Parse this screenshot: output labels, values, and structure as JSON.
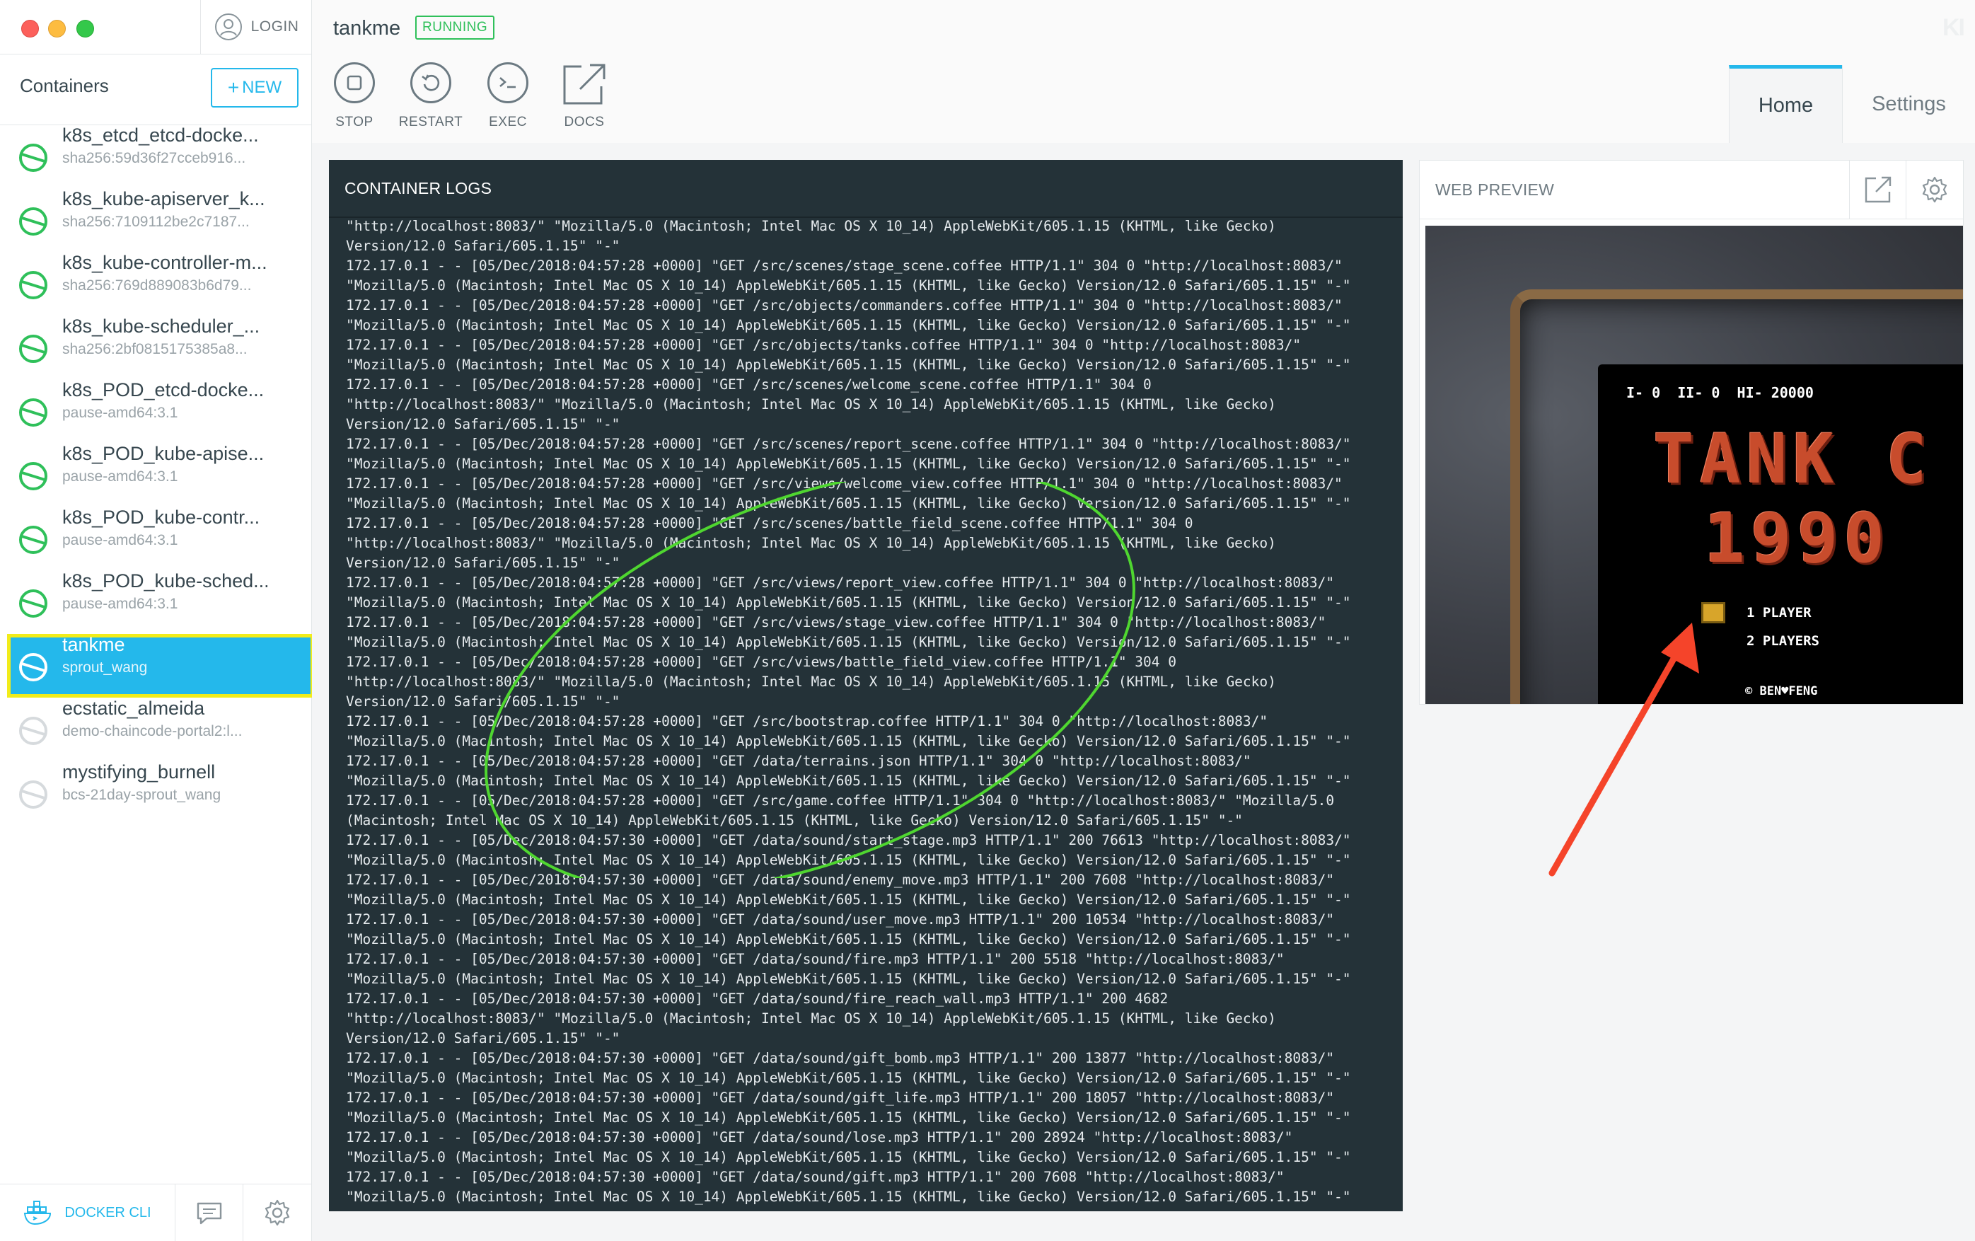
{
  "sidebar": {
    "login_label": "LOGIN",
    "containers_title": "Containers",
    "new_button": "NEW",
    "items": [
      {
        "name": "k8s_etcd_etcd-docke...",
        "sub": "sha256:59d36f27cceb916...",
        "state": "running"
      },
      {
        "name": "k8s_kube-apiserver_k...",
        "sub": "sha256:7109112be2c7187...",
        "state": "running"
      },
      {
        "name": "k8s_kube-controller-m...",
        "sub": "sha256:769d889083b6d79...",
        "state": "running"
      },
      {
        "name": "k8s_kube-scheduler_...",
        "sub": "sha256:2bf0815175385a8...",
        "state": "running"
      },
      {
        "name": "k8s_POD_etcd-docke...",
        "sub": "pause-amd64:3.1",
        "state": "running"
      },
      {
        "name": "k8s_POD_kube-apise...",
        "sub": "pause-amd64:3.1",
        "state": "running"
      },
      {
        "name": "k8s_POD_kube-contr...",
        "sub": "pause-amd64:3.1",
        "state": "running"
      },
      {
        "name": "k8s_POD_kube-sched...",
        "sub": "pause-amd64:3.1",
        "state": "running"
      },
      {
        "name": "tankme",
        "sub": "sprout_wang",
        "state": "selected"
      },
      {
        "name": "ecstatic_almeida",
        "sub": "demo-chaincode-portal2:l...",
        "state": "stopped"
      },
      {
        "name": "mystifying_burnell",
        "sub": "bcs-21day-sprout_wang",
        "state": "stopped"
      }
    ],
    "footer": {
      "docker_cli": "DOCKER CLI"
    }
  },
  "header": {
    "container_name": "tankme",
    "status": "RUNNING",
    "brand": "KI"
  },
  "toolbar": {
    "stop": "STOP",
    "restart": "RESTART",
    "exec": "EXEC",
    "docs": "DOCS"
  },
  "tabs": {
    "home": "Home",
    "settings": "Settings"
  },
  "logs": {
    "title": "CONTAINER LOGS",
    "lines": [
      "\"http://localhost:8083/\" \"Mozilla/5.0 (Macintosh; Intel Mac OS X 10_14) AppleWebKit/605.1.15 (KHTML, like Gecko)",
      "Version/12.0 Safari/605.1.15\" \"-\"",
      "172.17.0.1 - - [05/Dec/2018:04:57:28 +0000] \"GET /src/scenes/stage_scene.coffee HTTP/1.1\" 304 0 \"http://localhost:8083/\"",
      "\"Mozilla/5.0 (Macintosh; Intel Mac OS X 10_14) AppleWebKit/605.1.15 (KHTML, like Gecko) Version/12.0 Safari/605.1.15\" \"-\"",
      "172.17.0.1 - - [05/Dec/2018:04:57:28 +0000] \"GET /src/objects/commanders.coffee HTTP/1.1\" 304 0 \"http://localhost:8083/\"",
      "\"Mozilla/5.0 (Macintosh; Intel Mac OS X 10_14) AppleWebKit/605.1.15 (KHTML, like Gecko) Version/12.0 Safari/605.1.15\" \"-\"",
      "172.17.0.1 - - [05/Dec/2018:04:57:28 +0000] \"GET /src/objects/tanks.coffee HTTP/1.1\" 304 0 \"http://localhost:8083/\"",
      "\"Mozilla/5.0 (Macintosh; Intel Mac OS X 10_14) AppleWebKit/605.1.15 (KHTML, like Gecko) Version/12.0 Safari/605.1.15\" \"-\"",
      "172.17.0.1 - - [05/Dec/2018:04:57:28 +0000] \"GET /src/scenes/welcome_scene.coffee HTTP/1.1\" 304 0",
      "\"http://localhost:8083/\" \"Mozilla/5.0 (Macintosh; Intel Mac OS X 10_14) AppleWebKit/605.1.15 (KHTML, like Gecko)",
      "Version/12.0 Safari/605.1.15\" \"-\"",
      "172.17.0.1 - - [05/Dec/2018:04:57:28 +0000] \"GET /src/scenes/report_scene.coffee HTTP/1.1\" 304 0 \"http://localhost:8083/\"",
      "\"Mozilla/5.0 (Macintosh; Intel Mac OS X 10_14) AppleWebKit/605.1.15 (KHTML, like Gecko) Version/12.0 Safari/605.1.15\" \"-\"",
      "172.17.0.1 - - [05/Dec/2018:04:57:28 +0000] \"GET /src/views/welcome_view.coffee HTTP/1.1\" 304 0 \"http://localhost:8083/\"",
      "\"Mozilla/5.0 (Macintosh; Intel Mac OS X 10_14) AppleWebKit/605.1.15 (KHTML, like Gecko) Version/12.0 Safari/605.1.15\" \"-\"",
      "172.17.0.1 - - [05/Dec/2018:04:57:28 +0000] \"GET /src/scenes/battle_field_scene.coffee HTTP/1.1\" 304 0",
      "\"http://localhost:8083/\" \"Mozilla/5.0 (Macintosh; Intel Mac OS X 10_14) AppleWebKit/605.1.15 (KHTML, like Gecko)",
      "Version/12.0 Safari/605.1.15\" \"-\"",
      "172.17.0.1 - - [05/Dec/2018:04:57:28 +0000] \"GET /src/views/report_view.coffee HTTP/1.1\" 304 0 \"http://localhost:8083/\"",
      "\"Mozilla/5.0 (Macintosh; Intel Mac OS X 10_14) AppleWebKit/605.1.15 (KHTML, like Gecko) Version/12.0 Safari/605.1.15\" \"-\"",
      "172.17.0.1 - - [05/Dec/2018:04:57:28 +0000] \"GET /src/views/stage_view.coffee HTTP/1.1\" 304 0 \"http://localhost:8083/\"",
      "\"Mozilla/5.0 (Macintosh; Intel Mac OS X 10_14) AppleWebKit/605.1.15 (KHTML, like Gecko) Version/12.0 Safari/605.1.15\" \"-\"",
      "172.17.0.1 - - [05/Dec/2018:04:57:28 +0000] \"GET /src/views/battle_field_view.coffee HTTP/1.1\" 304 0",
      "\"http://localhost:8083/\" \"Mozilla/5.0 (Macintosh; Intel Mac OS X 10_14) AppleWebKit/605.1.15 (KHTML, like Gecko)",
      "Version/12.0 Safari/605.1.15\" \"-\"",
      "172.17.0.1 - - [05/Dec/2018:04:57:28 +0000] \"GET /src/bootstrap.coffee HTTP/1.1\" 304 0 \"http://localhost:8083/\"",
      "\"Mozilla/5.0 (Macintosh; Intel Mac OS X 10_14) AppleWebKit/605.1.15 (KHTML, like Gecko) Version/12.0 Safari/605.1.15\" \"-\"",
      "172.17.0.1 - - [05/Dec/2018:04:57:28 +0000] \"GET /data/terrains.json HTTP/1.1\" 304 0 \"http://localhost:8083/\"",
      "\"Mozilla/5.0 (Macintosh; Intel Mac OS X 10_14) AppleWebKit/605.1.15 (KHTML, like Gecko) Version/12.0 Safari/605.1.15\" \"-\"",
      "172.17.0.1 - - [05/Dec/2018:04:57:28 +0000] \"GET /src/game.coffee HTTP/1.1\" 304 0 \"http://localhost:8083/\" \"Mozilla/5.0",
      "(Macintosh; Intel Mac OS X 10_14) AppleWebKit/605.1.15 (KHTML, like Gecko) Version/12.0 Safari/605.1.15\" \"-\"",
      "172.17.0.1 - - [05/Dec/2018:04:57:30 +0000] \"GET /data/sound/start_stage.mp3 HTTP/1.1\" 200 76613 \"http://localhost:8083/\"",
      "\"Mozilla/5.0 (Macintosh; Intel Mac OS X 10_14) AppleWebKit/605.1.15 (KHTML, like Gecko) Version/12.0 Safari/605.1.15\" \"-\"",
      "172.17.0.1 - - [05/Dec/2018:04:57:30 +0000] \"GET /data/sound/enemy_move.mp3 HTTP/1.1\" 200 7608 \"http://localhost:8083/\"",
      "\"Mozilla/5.0 (Macintosh; Intel Mac OS X 10_14) AppleWebKit/605.1.15 (KHTML, like Gecko) Version/12.0 Safari/605.1.15\" \"-\"",
      "172.17.0.1 - - [05/Dec/2018:04:57:30 +0000] \"GET /data/sound/user_move.mp3 HTTP/1.1\" 200 10534 \"http://localhost:8083/\"",
      "\"Mozilla/5.0 (Macintosh; Intel Mac OS X 10_14) AppleWebKit/605.1.15 (KHTML, like Gecko) Version/12.0 Safari/605.1.15\" \"-\"",
      "172.17.0.1 - - [05/Dec/2018:04:57:30 +0000] \"GET /data/sound/fire.mp3 HTTP/1.1\" 200 5518 \"http://localhost:8083/\"",
      "\"Mozilla/5.0 (Macintosh; Intel Mac OS X 10_14) AppleWebKit/605.1.15 (KHTML, like Gecko) Version/12.0 Safari/605.1.15\" \"-\"",
      "172.17.0.1 - - [05/Dec/2018:04:57:30 +0000] \"GET /data/sound/fire_reach_wall.mp3 HTTP/1.1\" 200 4682",
      "\"http://localhost:8083/\" \"Mozilla/5.0 (Macintosh; Intel Mac OS X 10_14) AppleWebKit/605.1.15 (KHTML, like Gecko)",
      "Version/12.0 Safari/605.1.15\" \"-\"",
      "172.17.0.1 - - [05/Dec/2018:04:57:30 +0000] \"GET /data/sound/gift_bomb.mp3 HTTP/1.1\" 200 13877 \"http://localhost:8083/\"",
      "\"Mozilla/5.0 (Macintosh; Intel Mac OS X 10_14) AppleWebKit/605.1.15 (KHTML, like Gecko) Version/12.0 Safari/605.1.15\" \"-\"",
      "172.17.0.1 - - [05/Dec/2018:04:57:30 +0000] \"GET /data/sound/gift_life.mp3 HTTP/1.1\" 200 18057 \"http://localhost:8083/\"",
      "\"Mozilla/5.0 (Macintosh; Intel Mac OS X 10_14) AppleWebKit/605.1.15 (KHTML, like Gecko) Version/12.0 Safari/605.1.15\" \"-\"",
      "172.17.0.1 - - [05/Dec/2018:04:57:30 +0000] \"GET /data/sound/lose.mp3 HTTP/1.1\" 200 28924 \"http://localhost:8083/\"",
      "\"Mozilla/5.0 (Macintosh; Intel Mac OS X 10_14) AppleWebKit/605.1.15 (KHTML, like Gecko) Version/12.0 Safari/605.1.15\" \"-\"",
      "172.17.0.1 - - [05/Dec/2018:04:57:30 +0000] \"GET /data/sound/gift.mp3 HTTP/1.1\" 200 7608 \"http://localhost:8083/\"",
      "\"Mozilla/5.0 (Macintosh; Intel Mac OS X 10_14) AppleWebKit/605.1.15 (KHTML, like Gecko) Version/12.0 Safari/605.1.15\" \"-\""
    ]
  },
  "preview": {
    "title": "WEB PREVIEW",
    "game": {
      "hud": "I- 0  II- 0  HI- 20000",
      "title_line1": "TANK C",
      "title_line2": "1990",
      "option1": "1 PLAYER",
      "option2": "2 PLAYERS",
      "credit": "© BEN♥FENG"
    }
  },
  "colors": {
    "accent": "#24b8eb",
    "running": "#2fc05a",
    "log_bg": "#243238",
    "annotation_ellipse": "#4fd630",
    "annotation_arrow": "#f5442a"
  },
  "icons": {
    "login": "user-circle-icon",
    "new": "plus-icon",
    "running_container": "container-running-icon",
    "stopped_container": "container-stopped-icon",
    "stop": "stop-icon",
    "restart": "restart-icon",
    "exec": "terminal-icon",
    "docs": "external-link-icon",
    "preview_open": "external-link-icon",
    "preview_settings": "gear-icon",
    "docker_cli": "docker-whale-icon",
    "chat": "chat-icon",
    "settings": "gear-icon"
  }
}
